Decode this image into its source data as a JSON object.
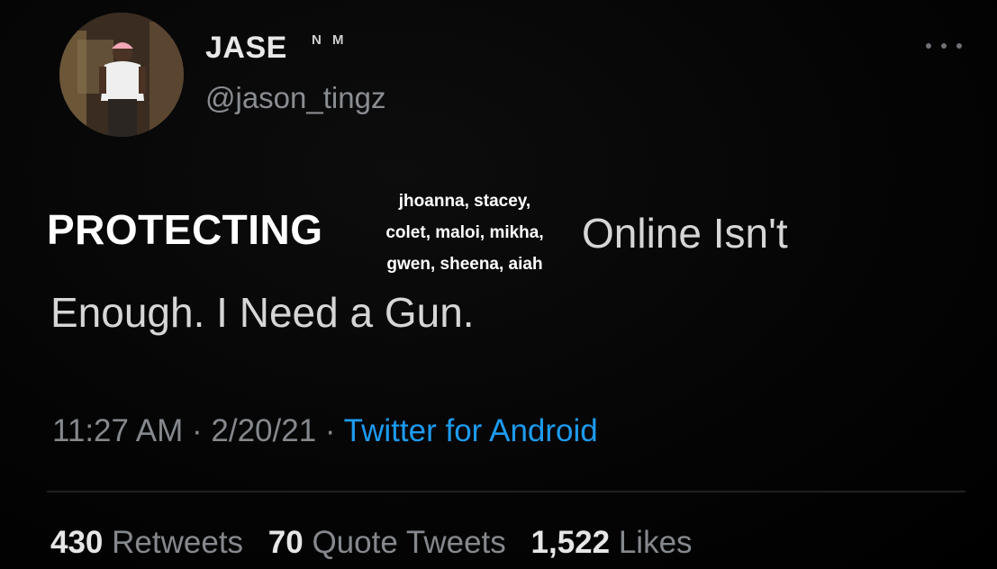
{
  "user": {
    "display_name": "JASE",
    "name_suffix": "N M",
    "handle": "@jason_tingz"
  },
  "tweet": {
    "overlay_word": "PROTECTING",
    "overlay_names": [
      "jhoanna, stacey,",
      "colet, maloi, mikha,",
      "gwen, sheena, aiah"
    ],
    "text_line1": "Online Isn't",
    "text_line2": "Enough. I Need a Gun."
  },
  "meta": {
    "time": "11:27 AM",
    "date": "2/20/21",
    "separator": "·",
    "source": "Twitter for Android"
  },
  "stats": {
    "retweets_count": "430",
    "retweets_label": "Retweets",
    "quotes_count": "70",
    "quotes_label": "Quote Tweets",
    "likes_count": "1,522",
    "likes_label": "Likes"
  },
  "colors": {
    "background": "#000000",
    "link": "#1d9bf0",
    "secondary_text": "#85888c"
  },
  "icons": {
    "more": "more-horizontal-icon"
  }
}
